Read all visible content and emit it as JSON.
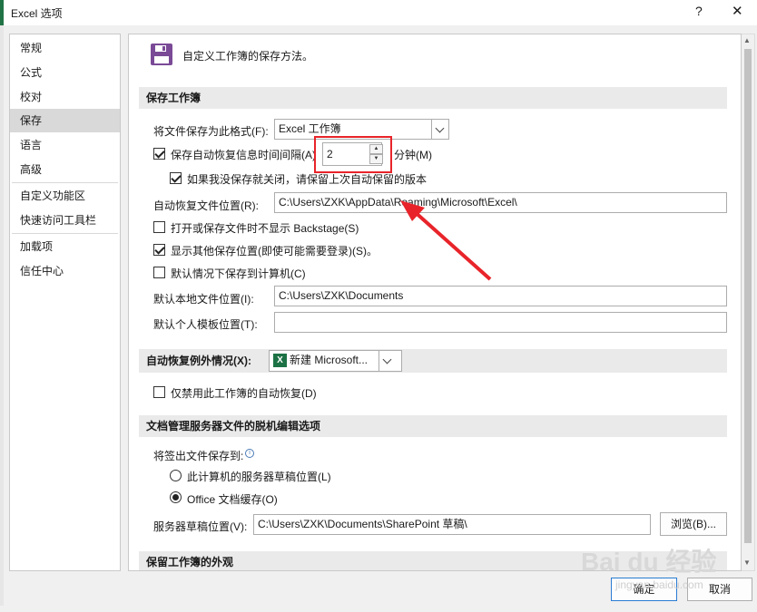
{
  "window": {
    "title": "Excel 选项",
    "help": "?",
    "close": "✕"
  },
  "sidebar": {
    "items": [
      {
        "label": "常规"
      },
      {
        "label": "公式"
      },
      {
        "label": "校对"
      },
      {
        "label": "保存",
        "selected": true
      },
      {
        "label": "语言"
      },
      {
        "label": "高级"
      },
      {
        "label": "自定义功能区"
      },
      {
        "label": "快速访问工具栏"
      },
      {
        "label": "加载项"
      },
      {
        "label": "信任中心"
      }
    ]
  },
  "header": {
    "icon": "save-icon",
    "text": "自定义工作簿的保存方法。"
  },
  "save_workbooks": {
    "heading": "保存工作簿",
    "format_label": "将文件保存为此格式(F):",
    "format_value": "Excel 工作簿",
    "autorecover_label": "保存自动恢复信息时间间隔(A)",
    "autorecover_checked": true,
    "autorecover_minutes": "2",
    "minutes_label": "分钟(M)",
    "keep_last_label": "如果我没保存就关闭，请保留上次自动保留的版本",
    "keep_last_checked": true,
    "autorecover_location_label": "自动恢复文件位置(R):",
    "autorecover_location_value": "C:\\Users\\ZXK\\AppData\\Roaming\\Microsoft\\Excel\\",
    "no_backstage_label": "打开或保存文件时不显示 Backstage(S)",
    "no_backstage_checked": false,
    "show_other_label": "显示其他保存位置(即使可能需要登录)(S)。",
    "show_other_checked": true,
    "save_computer_label": "默认情况下保存到计算机(C)",
    "save_computer_checked": false,
    "local_location_label": "默认本地文件位置(I):",
    "local_location_value": "C:\\Users\\ZXK\\Documents",
    "template_location_label": "默认个人模板位置(T):",
    "template_location_value": ""
  },
  "autorecover_exceptions": {
    "heading": "自动恢复例外情况(X):",
    "workbook_value": "新建 Microsoft...",
    "disable_label": "仅禁用此工作簿的自动恢复(D)",
    "disable_checked": false
  },
  "offline_editing": {
    "heading": "文档管理服务器文件的脱机编辑选项",
    "checkout_label": "将签出文件保存到:",
    "info_glyph": "i",
    "option_server": "此计算机的服务器草稿位置(L)",
    "option_cache": "Office 文档缓存(O)",
    "selected": "cache",
    "drafts_label": "服务器草稿位置(V):",
    "drafts_value": "C:\\Users\\ZXK\\Documents\\SharePoint 草稿\\",
    "browse_label": "浏览(B)..."
  },
  "preserve_visual": {
    "heading": "保留工作簿的外观"
  },
  "footer": {
    "ok_label": "确定",
    "cancel_label": "取消"
  },
  "watermark": {
    "text": "Bai du 经验",
    "sub": "jingyan.baidu.com"
  },
  "colors": {
    "excel_green": "#217346",
    "highlight_red": "#e8242a",
    "selected_bg": "#d9d9d9"
  }
}
